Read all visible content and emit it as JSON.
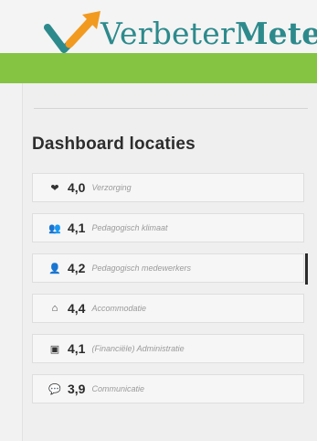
{
  "brand": {
    "name_regular": "Verbeter",
    "name_bold": "Mete"
  },
  "page": {
    "title": "Dashboard locaties"
  },
  "items": [
    {
      "icon": "heart-icon",
      "glyph": "❤",
      "score": "4,0",
      "label": "Verzorging",
      "active": false
    },
    {
      "icon": "group-icon",
      "glyph": "👥",
      "score": "4,1",
      "label": "Pedagogisch klimaat",
      "active": false
    },
    {
      "icon": "person-icon",
      "glyph": "👤",
      "score": "4,2",
      "label": "Pedagogisch medewerkers",
      "active": true
    },
    {
      "icon": "home-icon",
      "glyph": "⌂",
      "score": "4,4",
      "label": "Accommodatie",
      "active": false
    },
    {
      "icon": "money-icon",
      "glyph": "▣",
      "score": "4,1",
      "label": "(Financiële) Administratie",
      "active": false
    },
    {
      "icon": "chat-icon",
      "glyph": "💬",
      "score": "3,9",
      "label": "Communicatie",
      "active": false
    }
  ],
  "colors": {
    "brand_teal": "#2d8a8c",
    "band_green": "#85c443",
    "logo_orange": "#f29a1f"
  }
}
